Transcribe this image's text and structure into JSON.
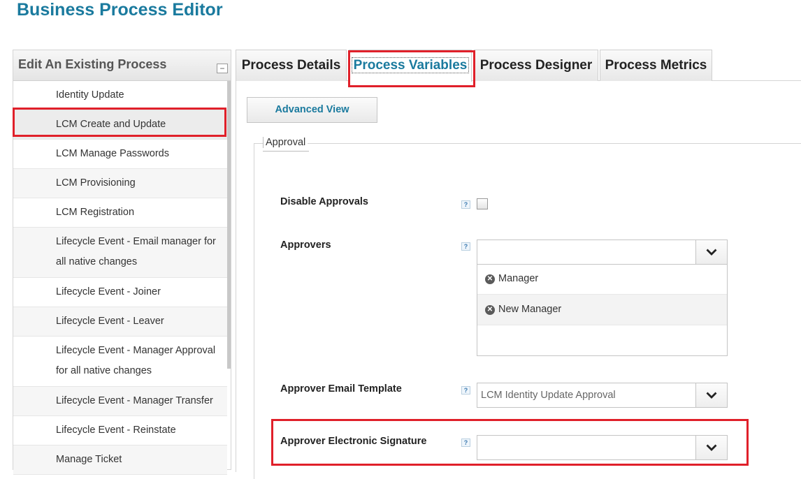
{
  "page": {
    "title": "Business Process Editor"
  },
  "sidebar": {
    "heading": "Edit An Existing Process",
    "collapse_symbol": "−",
    "items": [
      {
        "label": "Identity Update"
      },
      {
        "label": "LCM Create and Update"
      },
      {
        "label": "LCM Manage Passwords"
      },
      {
        "label": "LCM Provisioning"
      },
      {
        "label": "LCM Registration"
      },
      {
        "label": "Lifecycle Event - Email manager for all native changes"
      },
      {
        "label": "Lifecycle Event - Joiner"
      },
      {
        "label": "Lifecycle Event - Leaver"
      },
      {
        "label": "Lifecycle Event - Manager Approval for all native changes"
      },
      {
        "label": "Lifecycle Event - Manager Transfer"
      },
      {
        "label": "Lifecycle Event - Reinstate"
      },
      {
        "label": "Manage Ticket"
      }
    ],
    "selected_index": 1
  },
  "tabs": [
    {
      "label": "Process Details"
    },
    {
      "label": "Process Variables",
      "active": true
    },
    {
      "label": "Process Designer"
    },
    {
      "label": "Process Metrics"
    }
  ],
  "main": {
    "advanced_view_label": "Advanced View",
    "fieldset_legend": "Approval",
    "help_symbol": "?",
    "fields": {
      "disable_approvals": {
        "label": "Disable Approvals",
        "checked": false
      },
      "approvers": {
        "label": "Approvers",
        "value": "",
        "selected": [
          "Manager",
          "New Manager"
        ]
      },
      "approver_email_template": {
        "label": "Approver Email Template",
        "value": "LCM Identity Update Approval"
      },
      "approver_electronic_signature": {
        "label": "Approver Electronic Signature",
        "value": ""
      }
    }
  },
  "colors": {
    "accent": "#1a7a9e",
    "highlight": "#e0202a"
  },
  "icons": {
    "remove": "remove-circle-icon",
    "dropdown": "chevron-down-icon",
    "help": "help-icon"
  }
}
